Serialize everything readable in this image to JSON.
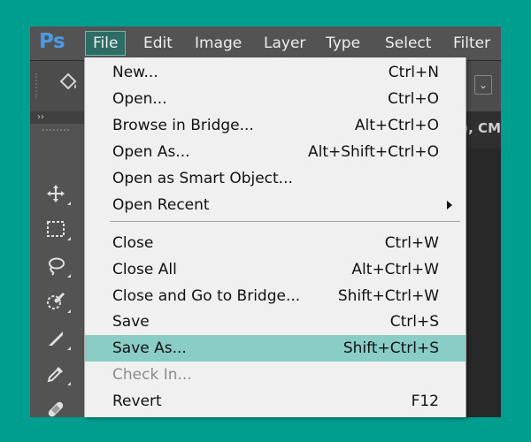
{
  "app": {
    "logo": "Ps"
  },
  "menubar": {
    "items": [
      {
        "label": "File",
        "active": true
      },
      {
        "label": "Edit"
      },
      {
        "label": "Image"
      },
      {
        "label": "Layer"
      },
      {
        "label": "Type"
      },
      {
        "label": "Select"
      },
      {
        "label": "Filter"
      }
    ]
  },
  "options_bar": {
    "dropdown_glyph": "⌄"
  },
  "document": {
    "tab_title": "), CM"
  },
  "toolbar": {
    "collapse_glyph": "››",
    "tools": [
      {
        "name": "move-tool",
        "icon": "move-icon"
      },
      {
        "name": "marquee-tool",
        "icon": "marquee-icon"
      },
      {
        "name": "lasso-tool",
        "icon": "lasso-icon"
      },
      {
        "name": "quick-selection-tool",
        "icon": "quick-selection-icon"
      },
      {
        "name": "crop-tool",
        "icon": "crop-icon"
      },
      {
        "name": "eyedropper-tool",
        "icon": "eyedropper-icon"
      },
      {
        "name": "healing-brush-tool",
        "icon": "bandage-icon"
      },
      {
        "name": "brush-tool",
        "icon": "brush-icon"
      }
    ]
  },
  "file_menu": {
    "group1": [
      {
        "label": "New...",
        "shortcut": "Ctrl+N"
      },
      {
        "label": "Open...",
        "shortcut": "Ctrl+O"
      },
      {
        "label": "Browse in Bridge...",
        "shortcut": "Alt+Ctrl+O"
      },
      {
        "label": "Open As...",
        "shortcut": "Alt+Shift+Ctrl+O"
      },
      {
        "label": "Open as Smart Object...",
        "shortcut": ""
      },
      {
        "label": "Open Recent",
        "shortcut": "",
        "submenu": true
      }
    ],
    "group2": [
      {
        "label": "Close",
        "shortcut": "Ctrl+W"
      },
      {
        "label": "Close All",
        "shortcut": "Alt+Ctrl+W"
      },
      {
        "label": "Close and Go to Bridge...",
        "shortcut": "Shift+Ctrl+W"
      },
      {
        "label": "Save",
        "shortcut": "Ctrl+S"
      },
      {
        "label": "Save As...",
        "shortcut": "Shift+Ctrl+S",
        "highlighted": true
      },
      {
        "label": "Check In...",
        "shortcut": "",
        "disabled": true
      },
      {
        "label": "Revert",
        "shortcut": "F12"
      }
    ]
  },
  "colors": {
    "background": "#009e8e",
    "highlight": "#89cdc6",
    "menu_bg": "#f0f0f0",
    "ps_blue": "#4a9be6"
  }
}
